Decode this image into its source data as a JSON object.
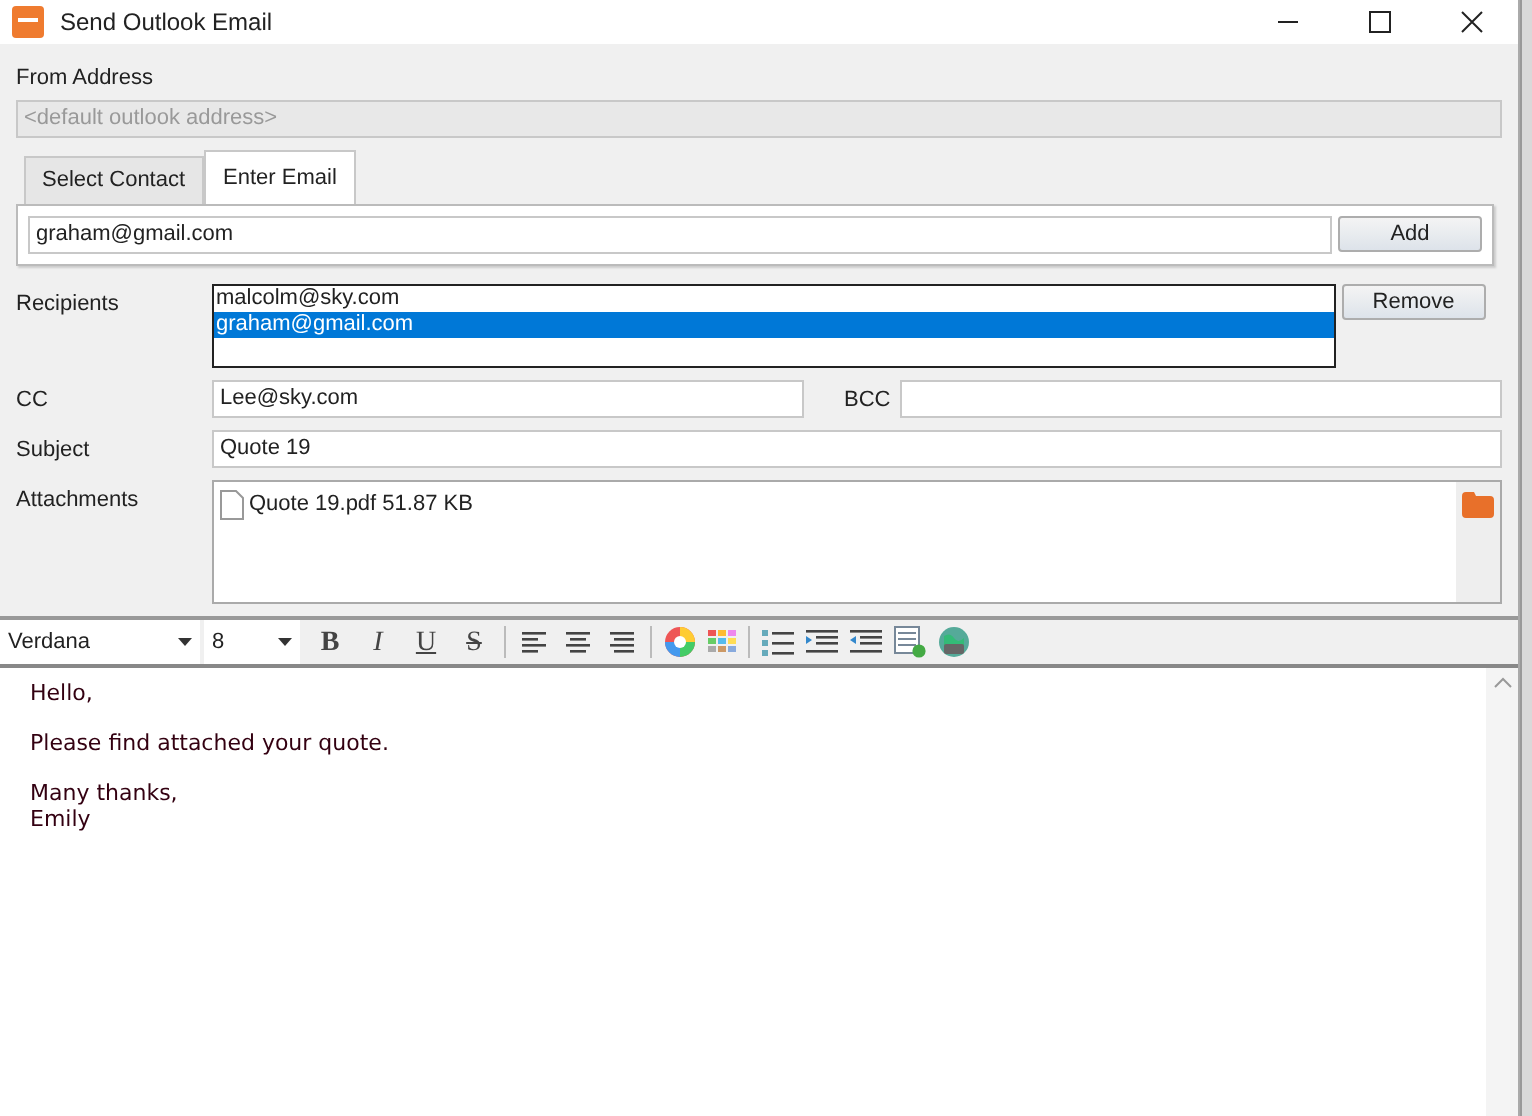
{
  "window": {
    "title": "Send Outlook Email"
  },
  "from_address": {
    "label": "From Address",
    "placeholder": "<default outlook address>",
    "disabled": true
  },
  "tabs": [
    {
      "label": "Select Contact",
      "selected": false
    },
    {
      "label": "Enter Email",
      "selected": true
    }
  ],
  "email_entry": {
    "value": "graham@gmail.com",
    "button": "Add"
  },
  "recipients": {
    "label": "Recipients",
    "button": "Remove",
    "items": [
      {
        "text": "malcolm@sky.com",
        "selected": false
      },
      {
        "text": "graham@gmail.com",
        "selected": true
      }
    ]
  },
  "cc": {
    "label": "CC",
    "value": "Lee@sky.com"
  },
  "bcc": {
    "label": "BCC"
  },
  "subject": {
    "label": "Subject",
    "value": "Quote 19"
  },
  "attachments": {
    "label": "Attachments",
    "files": [
      {
        "name": "Quote 19.pdf 51.87 KB"
      }
    ]
  },
  "toolbar": {
    "font": "Verdana",
    "size": "8",
    "format_buttons": [
      {
        "kind": "bold",
        "glyph": "B"
      },
      {
        "kind": "italic",
        "glyph": "I"
      },
      {
        "kind": "underline",
        "glyph": "U"
      },
      {
        "kind": "strike",
        "glyph": "S"
      }
    ]
  },
  "body": {
    "paragraphs": [
      {
        "lines": [
          "Hello,"
        ]
      },
      {
        "lines": [
          "Please find attached your quote."
        ]
      },
      {
        "lines": [
          "Many thanks,",
          "Emily"
        ]
      }
    ]
  }
}
